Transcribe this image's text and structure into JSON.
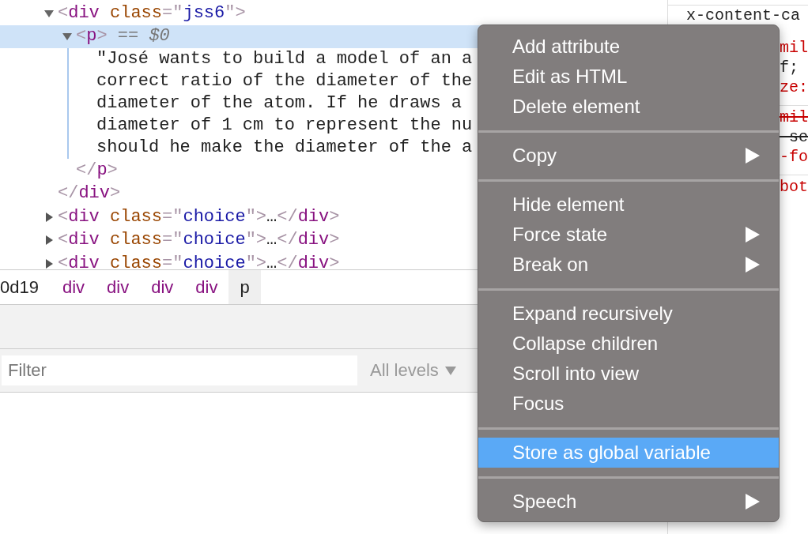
{
  "elements": {
    "nodes": [
      {
        "kind": "element",
        "expanded": true,
        "selected": false,
        "open": [
          {
            "kind": "punct",
            "s": "<"
          },
          {
            "kind": "tag",
            "s": "div"
          },
          {
            "kind": "attr",
            "s": " class"
          },
          {
            "kind": "punct",
            "s": "=\""
          },
          {
            "kind": "value",
            "s": "jss6"
          },
          {
            "kind": "punct",
            "s": "\">"
          }
        ],
        "children": [
          {
            "kind": "element",
            "expanded": true,
            "selected": true,
            "open": [
              {
                "kind": "punct",
                "s": "<"
              },
              {
                "kind": "tag",
                "s": "p"
              },
              {
                "kind": "punct",
                "s": ">"
              },
              {
                "kind": "marker",
                "s": " == "
              },
              {
                "kind": "var",
                "s": "$0"
              }
            ],
            "children": [
              {
                "kind": "text",
                "lines": [
                  "\"José wants to build a model of an a",
                  "correct ratio of the diameter of the",
                  "diameter of the atom. If he draws a",
                  "diameter of 1 cm to represent the nu",
                  "should he make the diameter of the a"
                ]
              }
            ],
            "close": [
              {
                "kind": "punct",
                "s": "</"
              },
              {
                "kind": "tag",
                "s": "p"
              },
              {
                "kind": "punct",
                "s": ">"
              }
            ]
          }
        ],
        "close": [
          {
            "kind": "punct",
            "s": "</"
          },
          {
            "kind": "tag",
            "s": "div"
          },
          {
            "kind": "punct",
            "s": ">"
          }
        ]
      },
      {
        "kind": "element",
        "expanded": false,
        "selected": false,
        "open": [
          {
            "kind": "punct",
            "s": "<"
          },
          {
            "kind": "tag",
            "s": "div"
          },
          {
            "kind": "attr",
            "s": " class"
          },
          {
            "kind": "punct",
            "s": "=\""
          },
          {
            "kind": "value",
            "s": "choice"
          },
          {
            "kind": "punct",
            "s": "\">"
          },
          {
            "kind": "ellipsis",
            "s": "…"
          },
          {
            "kind": "punct",
            "s": "</"
          },
          {
            "kind": "tag",
            "s": "div"
          },
          {
            "kind": "punct",
            "s": ">"
          }
        ]
      },
      {
        "kind": "element",
        "expanded": false,
        "selected": false,
        "open": [
          {
            "kind": "punct",
            "s": "<"
          },
          {
            "kind": "tag",
            "s": "div"
          },
          {
            "kind": "attr",
            "s": " class"
          },
          {
            "kind": "punct",
            "s": "=\""
          },
          {
            "kind": "value",
            "s": "choice"
          },
          {
            "kind": "punct",
            "s": "\">"
          },
          {
            "kind": "ellipsis",
            "s": "…"
          },
          {
            "kind": "punct",
            "s": "</"
          },
          {
            "kind": "tag",
            "s": "div"
          },
          {
            "kind": "punct",
            "s": ">"
          }
        ]
      },
      {
        "kind": "element",
        "expanded": false,
        "selected": false,
        "open": [
          {
            "kind": "punct",
            "s": "<"
          },
          {
            "kind": "tag",
            "s": "div"
          },
          {
            "kind": "attr",
            "s": " class"
          },
          {
            "kind": "punct",
            "s": "=\""
          },
          {
            "kind": "value",
            "s": "choice"
          },
          {
            "kind": "punct",
            "s": "\">"
          },
          {
            "kind": "ellipsis",
            "s": "…"
          },
          {
            "kind": "punct",
            "s": "</"
          },
          {
            "kind": "tag",
            "s": "div"
          },
          {
            "kind": "punct",
            "s": ">"
          }
        ]
      }
    ]
  },
  "breadcrumbs": [
    {
      "label": "0d19",
      "kind": "id",
      "selected": false
    },
    {
      "label": "div",
      "kind": "tag",
      "selected": false
    },
    {
      "label": "div",
      "kind": "tag",
      "selected": false
    },
    {
      "label": "div",
      "kind": "tag",
      "selected": false
    },
    {
      "label": "div",
      "kind": "tag",
      "selected": false
    },
    {
      "label": "p",
      "kind": "tag",
      "selected": true
    }
  ],
  "console": {
    "filter": {
      "placeholder": "Filter"
    },
    "levels": "All levels"
  },
  "styles": {
    "rules": [
      {
        "lines": [
          {
            "text": "x-content-ca",
            "kind": "selector",
            "struck": false
          },
          {
            "text": "mil",
            "kind": "property",
            "struck": false
          },
          {
            "text": "f;",
            "kind": "value",
            "struck": false
          },
          {
            "text": "ze:",
            "kind": "property",
            "struck": false
          }
        ]
      },
      {
        "lines": [
          {
            "text": "mil",
            "kind": "property",
            "struck": true
          },
          {
            "text": "-se",
            "kind": "value",
            "struck": true
          },
          {
            "text": "-fo",
            "kind": "property",
            "struck": false
          }
        ]
      },
      {
        "lines": [
          {
            "text": "bot",
            "kind": "property",
            "struck": false
          }
        ]
      }
    ]
  },
  "context_menu": {
    "items": [
      {
        "kind": "item",
        "label": "Add attribute",
        "submenu": false,
        "selected": false
      },
      {
        "kind": "item",
        "label": "Edit as HTML",
        "submenu": false,
        "selected": false
      },
      {
        "kind": "item",
        "label": "Delete element",
        "submenu": false,
        "selected": false
      },
      {
        "kind": "separator"
      },
      {
        "kind": "item",
        "label": "Copy",
        "submenu": true,
        "selected": false
      },
      {
        "kind": "separator"
      },
      {
        "kind": "item",
        "label": "Hide element",
        "submenu": false,
        "selected": false
      },
      {
        "kind": "item",
        "label": "Force state",
        "submenu": true,
        "selected": false
      },
      {
        "kind": "item",
        "label": "Break on",
        "submenu": true,
        "selected": false
      },
      {
        "kind": "separator"
      },
      {
        "kind": "item",
        "label": "Expand recursively",
        "submenu": false,
        "selected": false
      },
      {
        "kind": "item",
        "label": "Collapse children",
        "submenu": false,
        "selected": false
      },
      {
        "kind": "item",
        "label": "Scroll into view",
        "submenu": false,
        "selected": false
      },
      {
        "kind": "item",
        "label": "Focus",
        "submenu": false,
        "selected": false
      },
      {
        "kind": "separator"
      },
      {
        "kind": "item",
        "label": "Store as global variable",
        "submenu": false,
        "selected": true
      },
      {
        "kind": "separator"
      },
      {
        "kind": "item",
        "label": "Speech",
        "submenu": true,
        "selected": false
      }
    ]
  }
}
